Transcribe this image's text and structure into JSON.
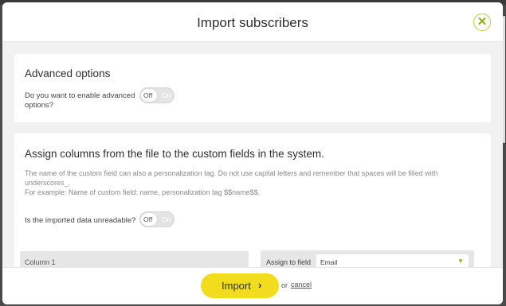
{
  "modal": {
    "title": "Import subscribers",
    "close_icon": "close-icon"
  },
  "advanced": {
    "heading": "Advanced options",
    "question_line1": "Do you want to enable advanced",
    "question_line2": "options?",
    "toggle": {
      "off_label": "Off",
      "on_label": "On",
      "state": "off"
    }
  },
  "assign": {
    "heading": "Assign columns from the file to the custom fields in the system.",
    "note_line1": "The name of the custom field can also a personalization tag. Do not use capital letters and remember that spaces will be filled with",
    "note_line2": "underscores_.",
    "note_line3": "For example: Name of custom field: name, personalization tag $$name$$.",
    "unreadable_question": "Is the imported data unreadable?",
    "toggle": {
      "off_label": "Off",
      "on_label": "On",
      "state": "off"
    },
    "column_label": "Column 1",
    "assign_label": "Assign to field",
    "assign_value": "Email",
    "select_icon": "chevron-down-icon"
  },
  "footer": {
    "import_label": "Import",
    "import_icon": "arrow-right-icon",
    "or_text": "or",
    "cancel_label": "cancel"
  },
  "colors": {
    "accent_yellow": "#f2dc1e",
    "accent_green": "#8fae18"
  }
}
